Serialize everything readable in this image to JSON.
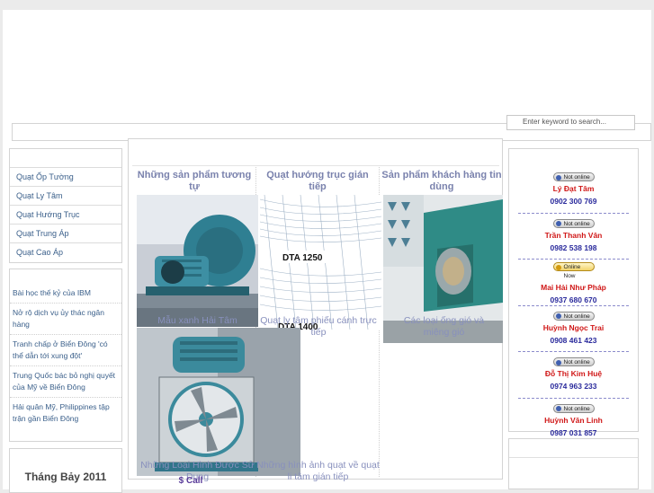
{
  "search": {
    "placeholder": "Enter keyword to search..."
  },
  "menu": {
    "items": [
      "Quạt Ốp Tường",
      "Quạt Ly Tâm",
      "Quạt Hướng Trục",
      "Quạt Trung Áp",
      "Quạt Cao Áp"
    ]
  },
  "news": {
    "items": [
      "Bài học thế kỷ của IBM",
      "Nở rộ dịch vụ ủy thác ngân hàng",
      "Tranh chấp ở Biển Đông 'có thể dẫn tới xung đột'",
      "Trung Quốc bác bỏ nghị quyết của Mỹ về Biển Đông",
      "Hải quân Mỹ, Philippines tập trận gần Biển Đông"
    ]
  },
  "calendar": {
    "month": "Tháng Bảy 2011"
  },
  "products": {
    "row1": [
      {
        "title": "Những sản phẩm tương tự",
        "caption": "Mẫu xanh Hải Tâm"
      },
      {
        "title": "Quạt hướng trục gián tiếp",
        "caption": "Quạt ly tâm phiếu cánh trực tiếp",
        "chart_label_1": "DTA 1250",
        "chart_label_2": "DTA 1400"
      },
      {
        "title": "Sản phẩm khách hàng tin dùng",
        "caption": "Các loại ống gió và miệng gió"
      }
    ],
    "row2": [
      {
        "caption": "Những Loại Hình Được Sử Dụng",
        "price": "$ Call"
      },
      {
        "caption": "Những hình ảnh quạt về quạt li tâm gián tiếp"
      }
    ]
  },
  "support": [
    {
      "status": "Not online",
      "name": "Lý Đạt Tâm",
      "phone": "0902 300 769"
    },
    {
      "status": "Not online",
      "name": "Trần Thanh Vân",
      "phone": "0982 538 198"
    },
    {
      "status": "Online Now",
      "name": "Mai Hải Như Pháp",
      "phone": "0937 680 670"
    },
    {
      "status": "Not online",
      "name": "Huỳnh Ngọc Trai",
      "phone": "0908 461 423"
    },
    {
      "status": "Not online",
      "name": "Đỗ Thị Kim Huệ",
      "phone": "0974 963 233"
    },
    {
      "status": "Not online",
      "name": "Huỳnh Văn Linh",
      "phone": "0987 031 857"
    }
  ],
  "colors": {
    "link": "#3a5f8a",
    "support_name": "#d01818",
    "support_phone": "#2a2a9c",
    "product_title": "#7a82ad",
    "machine_teal": "#3f8a9a"
  }
}
